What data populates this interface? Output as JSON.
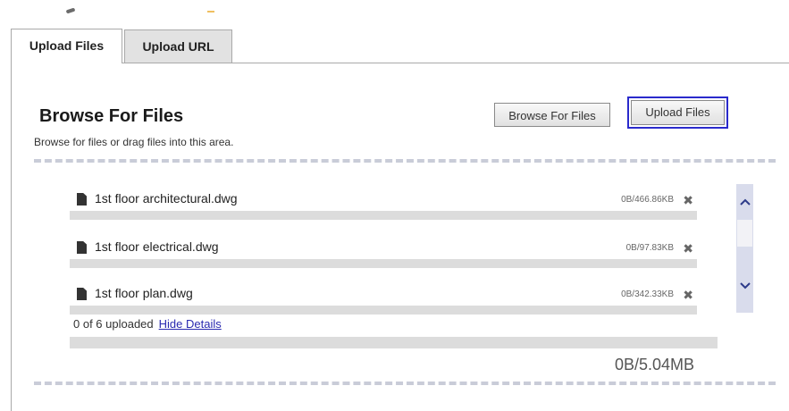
{
  "tabs": [
    {
      "label": "Upload Files",
      "active": true
    },
    {
      "label": "Upload URL",
      "active": false
    }
  ],
  "browse": {
    "title": "Browse For Files",
    "subtitle": "Browse for files or drag files into this area.",
    "browse_button": "Browse For Files",
    "upload_button": "Upload Files"
  },
  "files": [
    {
      "name": "1st floor architectural.dwg",
      "size": "0B/466.86KB",
      "progress": 0
    },
    {
      "name": "1st floor electrical.dwg",
      "size": "0B/97.83KB",
      "progress": 0
    },
    {
      "name": "1st floor plan.dwg",
      "size": "0B/342.33KB",
      "progress": 0
    }
  ],
  "summary": {
    "status": "0 of 6 uploaded",
    "toggle_link": "Hide Details",
    "total": "0B/5.04MB",
    "total_progress": 0
  },
  "icons": {
    "file": "file-icon",
    "remove": "close-icon",
    "scroll_up": "chevron-up-icon",
    "scroll_down": "chevron-down-icon"
  },
  "colors": {
    "focus_border": "#2a2acc",
    "progress_track": "#dcdcdc",
    "scrollbar": "#d9dcec",
    "link": "#2a2ab0"
  }
}
